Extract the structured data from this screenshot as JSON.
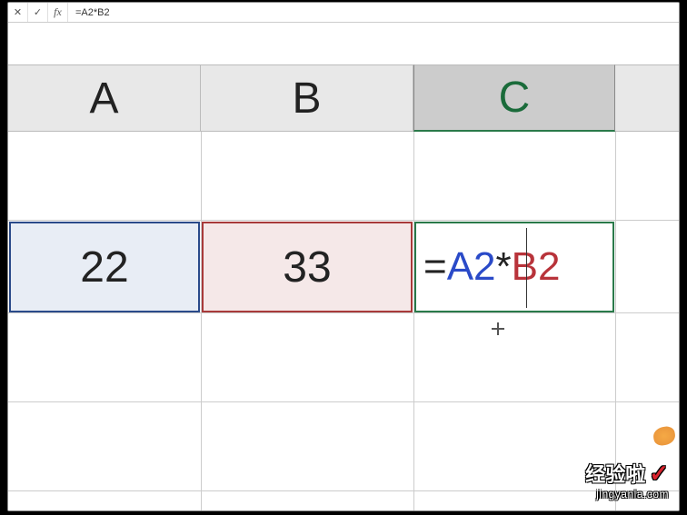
{
  "formula_bar": {
    "cancel_icon": "✕",
    "confirm_icon": "✓",
    "fx_label": "fx",
    "formula": "=A2*B2"
  },
  "columns": {
    "a": "A",
    "b": "B",
    "c": "C"
  },
  "cells": {
    "a2": "22",
    "b2": "33",
    "c2": {
      "eq": "=",
      "ref_a": "A2",
      "op": "*",
      "ref_b": "B2"
    }
  },
  "watermark": {
    "title": "经验啦",
    "check": "✓",
    "url": "jingyanla.com"
  }
}
